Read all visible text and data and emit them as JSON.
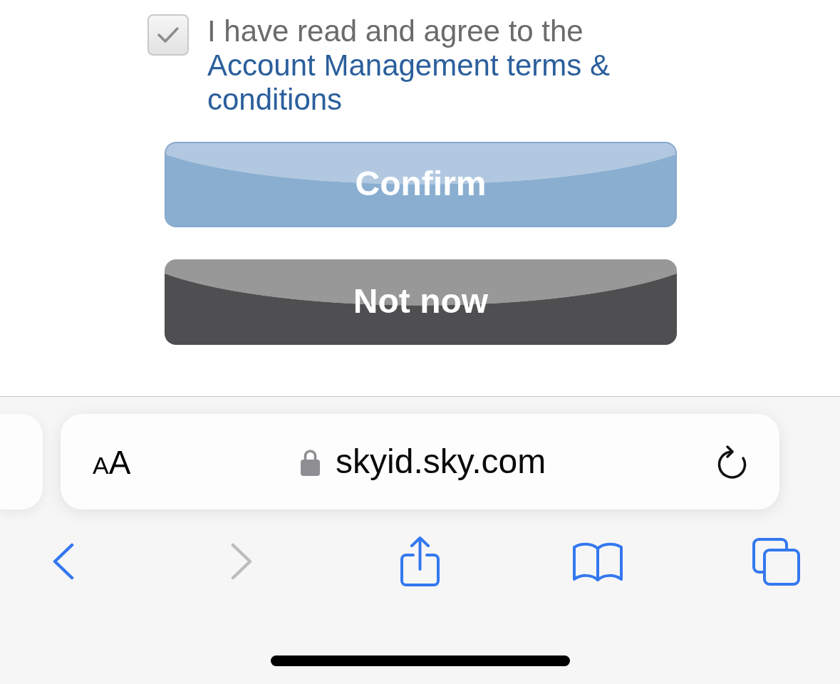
{
  "agreement": {
    "checked": true,
    "text": "I have read and agree to the",
    "link": "Account Management terms & conditions"
  },
  "buttons": [
    {
      "label": "Confirm",
      "kind": "primary",
      "disabled": true
    },
    {
      "label": "Not now",
      "kind": "secondary",
      "disabled": false
    }
  ],
  "address_bar": {
    "text_size_button": "AA",
    "secure": true,
    "url": "skyid.sky.com"
  },
  "toolbar": [
    {
      "kind": "back",
      "disabled": false
    },
    {
      "kind": "forward",
      "disabled": true
    },
    {
      "kind": "share",
      "disabled": false
    },
    {
      "kind": "bookmarks",
      "disabled": false
    },
    {
      "kind": "tabs",
      "disabled": false
    }
  ]
}
